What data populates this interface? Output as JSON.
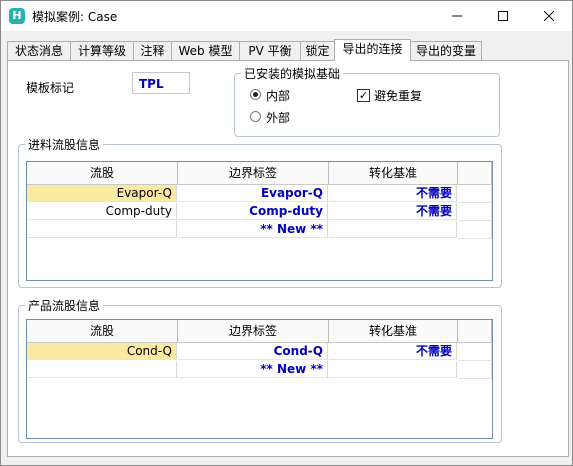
{
  "window": {
    "icon_letter": "H",
    "title": "模拟案例: Case",
    "minimize": "—",
    "maximize": "☐",
    "close": "✕"
  },
  "tabs": [
    {
      "label": "状态消息"
    },
    {
      "label": "计算等级"
    },
    {
      "label": "注释"
    },
    {
      "label": "Web 模型"
    },
    {
      "label": "PV 平衡"
    },
    {
      "label": "锁定"
    },
    {
      "label": "导出的连接"
    },
    {
      "label": "导出的变量"
    }
  ],
  "active_tab_index": 6,
  "template": {
    "label": "模板标记",
    "value": "TPL"
  },
  "installed_basis": {
    "legend": "已安装的模拟基础",
    "internal_label": "内部",
    "external_label": "外部",
    "selected": "internal",
    "avoid_duplicates_label": "避免重复",
    "avoid_duplicates_checked": true
  },
  "feed_streams": {
    "legend": "进料流股信息",
    "columns": [
      "流股",
      "边界标签",
      "转化基准"
    ],
    "rows": [
      {
        "stream": "Evapor-Q",
        "boundary": "Evapor-Q",
        "basis": "不需要",
        "selected": true
      },
      {
        "stream": "Comp-duty",
        "boundary": "Comp-duty",
        "basis": "不需要",
        "selected": false
      },
      {
        "stream": "",
        "boundary": "** New **",
        "basis": "",
        "selected": false
      }
    ]
  },
  "product_streams": {
    "legend": "产品流股信息",
    "columns": [
      "流股",
      "边界标签",
      "转化基准"
    ],
    "rows": [
      {
        "stream": "Cond-Q",
        "boundary": "Cond-Q",
        "basis": "不需要",
        "selected": true
      },
      {
        "stream": "",
        "boundary": "** New **",
        "basis": "",
        "selected": false
      }
    ]
  },
  "colors": {
    "selection": "#fce9a2",
    "value_text": "#0000c0",
    "app_icon": "#2bb0b0"
  }
}
